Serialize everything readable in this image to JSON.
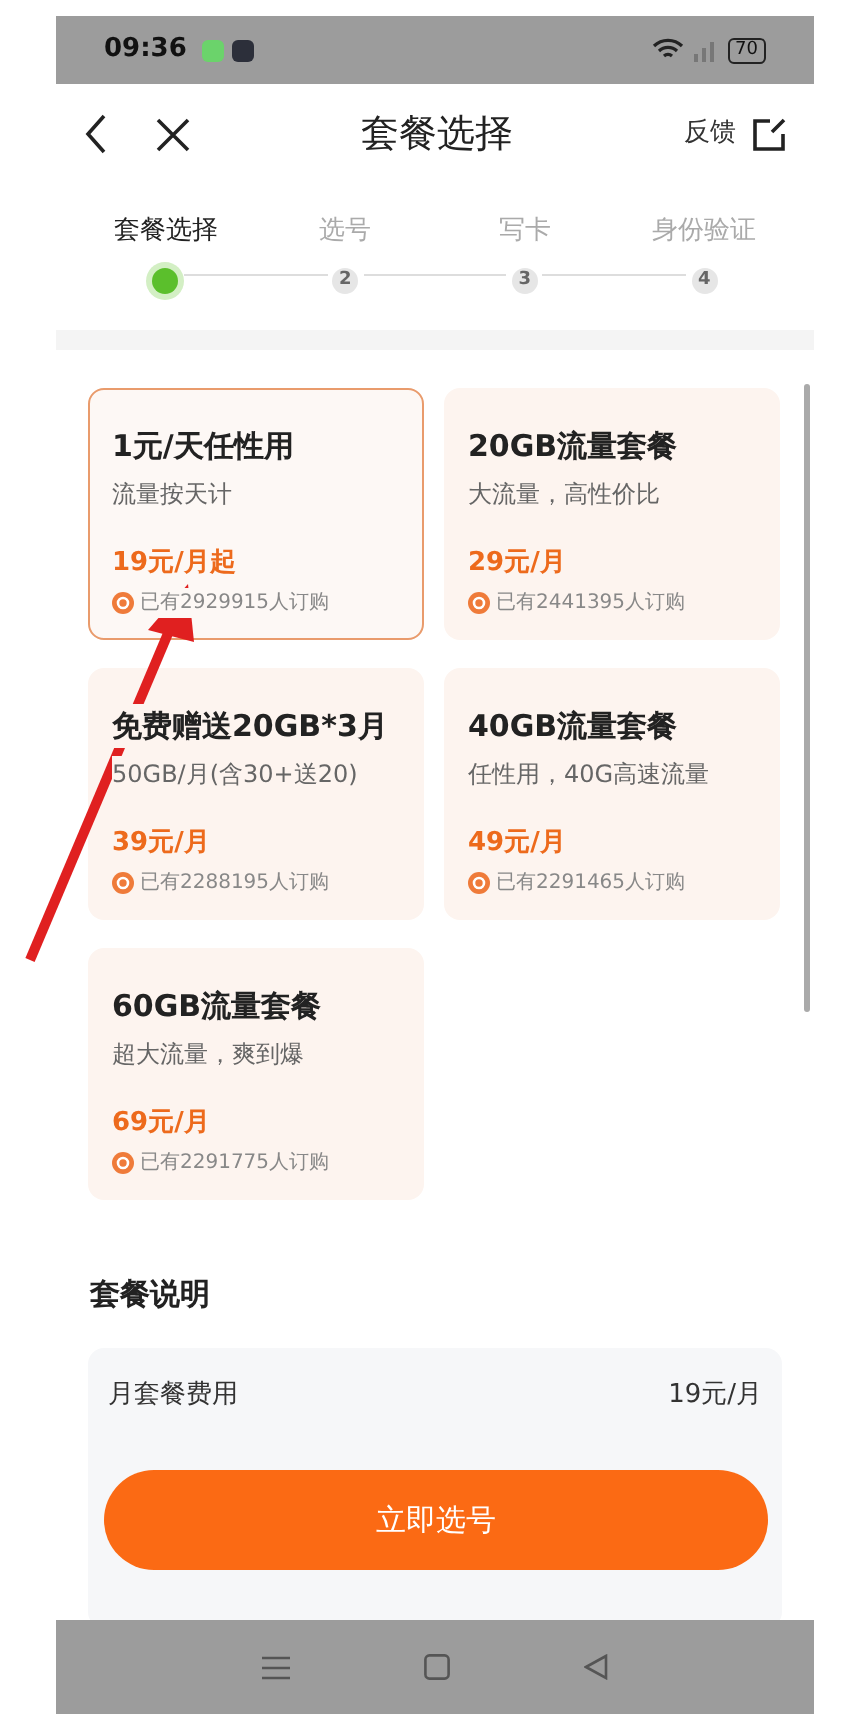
{
  "status_bar": {
    "time": "09:36",
    "battery": "70"
  },
  "header": {
    "title": "套餐选择",
    "feedback": "反馈"
  },
  "steps": [
    {
      "label": "套餐选择",
      "active": true
    },
    {
      "label": "选号",
      "number": "2",
      "active": false
    },
    {
      "label": "写卡",
      "number": "3",
      "active": false
    },
    {
      "label": "身份验证",
      "number": "4",
      "active": false
    }
  ],
  "plans": [
    {
      "title": "1元/天任性用",
      "subtitle": "流量按天计",
      "price": "19元/月起",
      "subscribers": "已有2929915人订购",
      "selected": true
    },
    {
      "title": "20GB流量套餐",
      "subtitle": "大流量，高性价比",
      "price": "29元/月",
      "subscribers": "已有2441395人订购",
      "selected": false
    },
    {
      "title": "免费赠送20GB*3月",
      "subtitle": "50GB/月(含30+送20)",
      "price": "39元/月",
      "subscribers": "已有2288195人订购",
      "selected": false
    },
    {
      "title": "40GB流量套餐",
      "subtitle": "任性用，40G高速流量",
      "price": "49元/月",
      "subscribers": "已有2291465人订购",
      "selected": false
    },
    {
      "title": "60GB流量套餐",
      "subtitle": "超大流量，爽到爆",
      "price": "69元/月",
      "subscribers": "已有2291775人订购",
      "selected": false
    }
  ],
  "description": {
    "title": "套餐说明",
    "rows": [
      {
        "label": "月套餐费用",
        "value": "19元/月"
      }
    ]
  },
  "action_button": "立即选号"
}
